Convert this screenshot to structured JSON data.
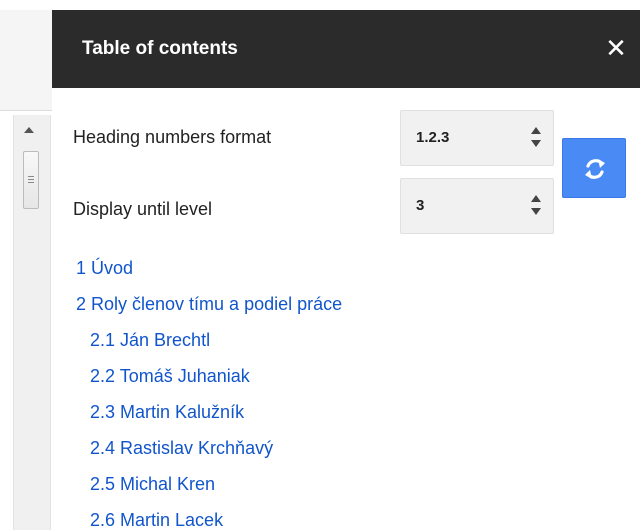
{
  "panel": {
    "title": "Table of contents",
    "close_glyph": "✕"
  },
  "settings": {
    "heading_format_label": "Heading numbers format",
    "heading_format_value": "1.2.3",
    "display_level_label": "Display until level",
    "display_level_value": "3"
  },
  "toc": {
    "items": [
      {
        "text": "1 Úvod",
        "level": 1
      },
      {
        "text": "2 Roly členov tímu a podiel práce",
        "level": 1
      },
      {
        "text": "2.1 Ján Brechtl",
        "level": 2
      },
      {
        "text": "2.2 Tomáš Juhaniak",
        "level": 2
      },
      {
        "text": "2.3 Martin Kalužník",
        "level": 2
      },
      {
        "text": "2.4 Rastislav Krchňavý",
        "level": 2
      },
      {
        "text": "2.5 Michal Kren",
        "level": 2
      },
      {
        "text": "2.6 Martin Lacek",
        "level": 2
      }
    ]
  },
  "colors": {
    "header_bg": "#2b2b2b",
    "link": "#1155cc",
    "accent_button": "#4a8af4"
  },
  "icons": {
    "close": "close-icon",
    "refresh": "refresh-icon",
    "scroll_up": "scroll-up-arrow-icon"
  }
}
